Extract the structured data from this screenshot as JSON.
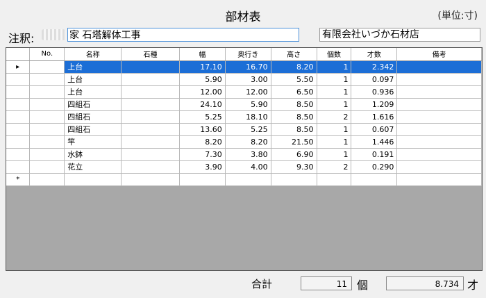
{
  "header": {
    "title": "部材表",
    "unit": "(単位:寸)"
  },
  "note": {
    "label": "注釈:",
    "value": "家 石塔解体工事"
  },
  "company": "有限会社いづか石材店",
  "table": {
    "columns": [
      "No.",
      "名称",
      "石種",
      "幅",
      "奥行き",
      "高さ",
      "個数",
      "才数",
      "備考"
    ],
    "rows": [
      {
        "no": "",
        "name": "上台",
        "stone": "",
        "width": "17.10",
        "depth": "16.70",
        "height": "8.20",
        "count": "1",
        "sai": "2.342",
        "note": ""
      },
      {
        "no": "",
        "name": "上台",
        "stone": "",
        "width": "5.90",
        "depth": "3.00",
        "height": "5.50",
        "count": "1",
        "sai": "0.097",
        "note": ""
      },
      {
        "no": "",
        "name": "上台",
        "stone": "",
        "width": "12.00",
        "depth": "12.00",
        "height": "6.50",
        "count": "1",
        "sai": "0.936",
        "note": ""
      },
      {
        "no": "",
        "name": "四組石",
        "stone": "",
        "width": "24.10",
        "depth": "5.90",
        "height": "8.50",
        "count": "1",
        "sai": "1.209",
        "note": ""
      },
      {
        "no": "",
        "name": "四組石",
        "stone": "",
        "width": "5.25",
        "depth": "18.10",
        "height": "8.50",
        "count": "2",
        "sai": "1.616",
        "note": ""
      },
      {
        "no": "",
        "name": "四組石",
        "stone": "",
        "width": "13.60",
        "depth": "5.25",
        "height": "8.50",
        "count": "1",
        "sai": "0.607",
        "note": ""
      },
      {
        "no": "",
        "name": "竿",
        "stone": "",
        "width": "8.20",
        "depth": "8.20",
        "height": "21.50",
        "count": "1",
        "sai": "1.446",
        "note": ""
      },
      {
        "no": "",
        "name": "水鉢",
        "stone": "",
        "width": "7.30",
        "depth": "3.80",
        "height": "6.90",
        "count": "1",
        "sai": "0.191",
        "note": ""
      },
      {
        "no": "",
        "name": "花立",
        "stone": "",
        "width": "3.90",
        "depth": "4.00",
        "height": "9.30",
        "count": "2",
        "sai": "0.290",
        "note": ""
      }
    ],
    "current_marker": "▸",
    "new_row_marker": "*"
  },
  "footer": {
    "total_label": "合計",
    "count": "11",
    "count_unit": "個",
    "total": "8.734",
    "total_unit": "才"
  }
}
